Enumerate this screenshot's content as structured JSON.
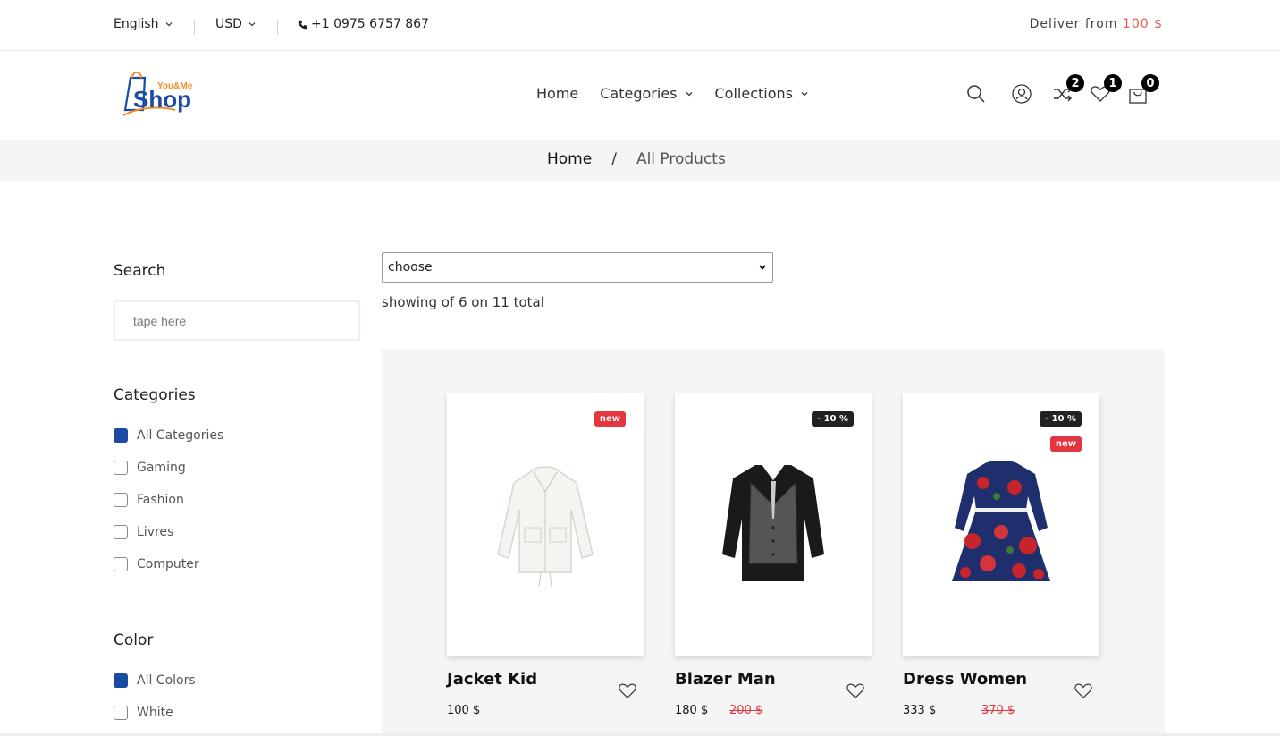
{
  "topbar": {
    "language": "English",
    "currency": "USD",
    "phone": "+1 0975 6757 867",
    "deliver_label": "Deliver from",
    "deliver_amount": "100 $"
  },
  "logo": {
    "small": "You&Me",
    "big": "Shop"
  },
  "nav": {
    "home": "Home",
    "categories": "Categories",
    "collections": "Collections"
  },
  "badges": {
    "compare": "2",
    "wishlist": "1",
    "cart": "0"
  },
  "breadcrumb": {
    "home": "Home",
    "separator": "/",
    "current": "All Products"
  },
  "sidebar": {
    "search_title": "Search",
    "search_placeholder": "tape here",
    "categories_title": "Categories",
    "categories": [
      {
        "label": "All Categories",
        "checked": true
      },
      {
        "label": "Gaming",
        "checked": false
      },
      {
        "label": "Fashion",
        "checked": false
      },
      {
        "label": "Livres",
        "checked": false
      },
      {
        "label": "Computer",
        "checked": false
      }
    ],
    "color_title": "Color",
    "colors": [
      {
        "label": "All Colors",
        "checked": true
      },
      {
        "label": "White",
        "checked": false
      }
    ]
  },
  "sort": {
    "selected": "choose"
  },
  "showing": "showing of 6 on 11 total",
  "products": [
    {
      "name": "Jacket Kid",
      "price": "100 $",
      "old_price": "",
      "tags": [
        "new"
      ]
    },
    {
      "name": "Blazer Man",
      "price": "180 $",
      "old_price": "200 $",
      "tags": [
        "- 10 %"
      ]
    },
    {
      "name": "Dress Women",
      "price": "333 $",
      "old_price": "370 $",
      "tags": [
        "- 10 %",
        "new"
      ]
    }
  ],
  "colors": {
    "brand_blue": "#1a4aa3",
    "accent_orange": "#f28c28",
    "sale_red": "#e4363f"
  }
}
